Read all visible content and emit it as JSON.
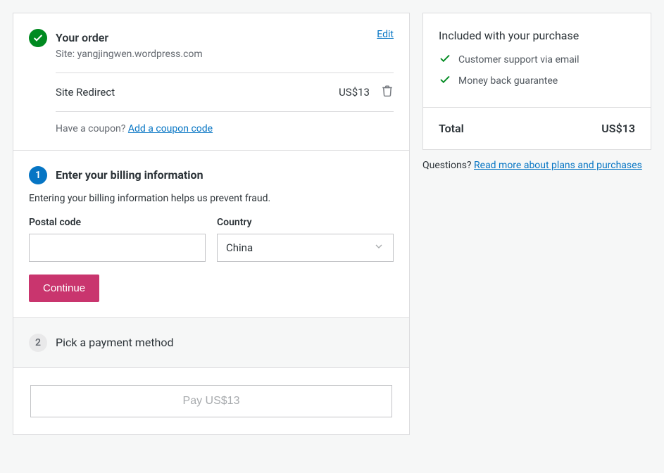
{
  "order": {
    "title": "Your order",
    "site_label_prefix": "Site: ",
    "site": "yangjingwen.wordpress.com",
    "edit_label": "Edit",
    "item_name": "Site Redirect",
    "item_price": "US$13",
    "coupon_prompt": "Have a coupon? ",
    "coupon_link": "Add a coupon code"
  },
  "billing": {
    "step_number": "1",
    "title": "Enter your billing information",
    "helper": "Entering your billing information helps us prevent fraud.",
    "postal_label": "Postal code",
    "postal_value": "",
    "country_label": "Country",
    "country_value": "China",
    "continue_label": "Continue"
  },
  "payment": {
    "step_number": "2",
    "title": "Pick a payment method"
  },
  "pay": {
    "button_label": "Pay US$13"
  },
  "sidebar": {
    "included_title": "Included with your purchase",
    "items": [
      "Customer support via email",
      "Money back guarantee"
    ],
    "total_label": "Total",
    "total_value": "US$13",
    "questions_prompt": "Questions? ",
    "questions_link": "Read more about plans and purchases"
  }
}
